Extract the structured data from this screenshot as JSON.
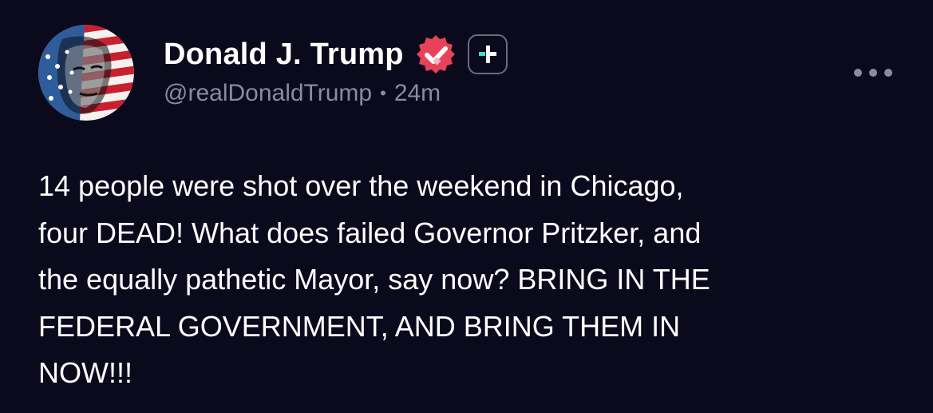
{
  "author": {
    "display_name": "Donald J. Trump",
    "handle": "@realDonaldTrump",
    "time_ago": "24m",
    "verified_icon": "verified-check-icon",
    "badge_icon": "plus-badge-icon",
    "verified_color": "#e8425b",
    "badge_accent": "#3fe0c5"
  },
  "meta": {
    "separator": "•"
  },
  "post": {
    "text": "14 people were shot over the weekend in Chicago,\nfour DEAD! What does failed Governor Pritzker, and\nthe equally pathetic Mayor, say now? BRING IN THE\nFEDERAL GOVERNMENT, AND BRING THEM IN\nNOW!!!"
  },
  "actions": {
    "more_icon": "more-options-icon"
  },
  "theme": {
    "background": "#0b0a1d",
    "text_primary": "#ffffff",
    "text_secondary": "#8b8a9e"
  }
}
